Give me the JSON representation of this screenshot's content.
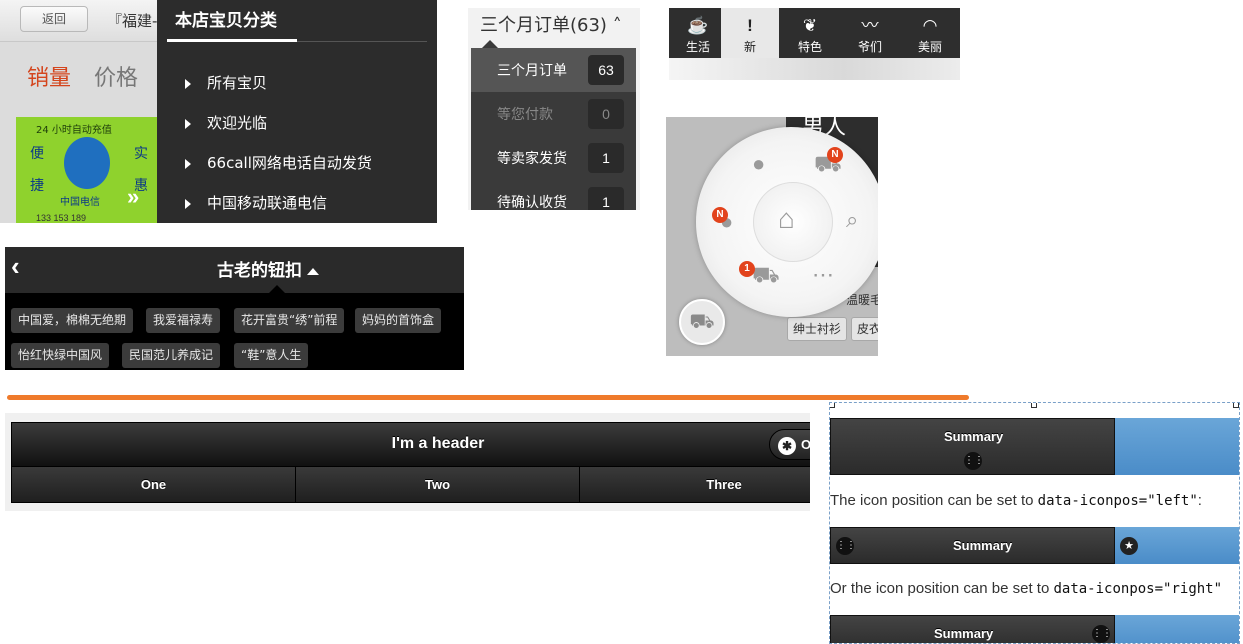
{
  "shop_panel": {
    "back_label": "返回",
    "store_name": "『福建-",
    "sort_sales": "销量",
    "sort_price": "价格",
    "product_ad_top": "24 小时自动充值",
    "product_side_left": [
      "便",
      "捷"
    ],
    "product_side_right": [
      "实",
      "惠"
    ],
    "product_brand": "中国电信",
    "product_numbers": "133 153 189",
    "menu_title": "本店宝贝分类",
    "menu_items": [
      {
        "label": "所有宝贝"
      },
      {
        "label": "欢迎光临"
      },
      {
        "label": "66call网络电话自动发货"
      },
      {
        "label": "中国移动联通电信"
      }
    ]
  },
  "orders_panel": {
    "header": "三个月订单(63)",
    "rows": [
      {
        "label": "三个月订单",
        "count": "63"
      },
      {
        "label": "等您付款",
        "count": "0"
      },
      {
        "label": "等卖家发货",
        "count": "1"
      },
      {
        "label": "待确认收货",
        "count": "1"
      }
    ]
  },
  "category_tabs": {
    "tabs": [
      {
        "label": "生活",
        "icon": "cup-icon",
        "glyph": "☕"
      },
      {
        "label": "新",
        "icon": "exclamation-icon",
        "glyph": "!"
      },
      {
        "label": "特色",
        "icon": "feather-icon",
        "glyph": "❦"
      },
      {
        "label": "爷们",
        "icon": "mustache-icon",
        "glyph": "〰"
      },
      {
        "label": "美丽",
        "icon": "lips-icon",
        "glyph": "◠"
      }
    ]
  },
  "radial_menu": {
    "bg_title": "男人",
    "badges": {
      "cart": "N",
      "chat": "N",
      "truck": "1"
    },
    "chips": [
      "绅士衬衫",
      "皮衣"
    ],
    "warm_text": "温暖毛",
    "colors": {
      "badge": "#e2431c"
    }
  },
  "tag_panel": {
    "title": "古老的钮扣",
    "tags": [
      "中国爱，棉棉无绝期",
      "我爱福禄寿",
      "花开富贵“绣”前程",
      "妈妈的首饰盒",
      "怡红快绿中国风",
      "民国范儿养成记",
      "“鞋”意人生"
    ]
  },
  "jqm_header": {
    "title": "I'm a header",
    "options_label": "O",
    "nav": [
      "One",
      "Two",
      "Three"
    ]
  },
  "collapsible_demo": {
    "summary_label": "Summary",
    "text_left_prefix": "The icon position can be set to ",
    "text_left_code": "data-iconpos=\"left\"",
    "text_left_suffix": ":",
    "text_right_prefix": "Or the icon position can be set to ",
    "text_right_code": "data-iconpos=\"right\"",
    "colors": {
      "accent_blue": "#5a9ad2"
    }
  },
  "divider_color": "#ef7a2b"
}
